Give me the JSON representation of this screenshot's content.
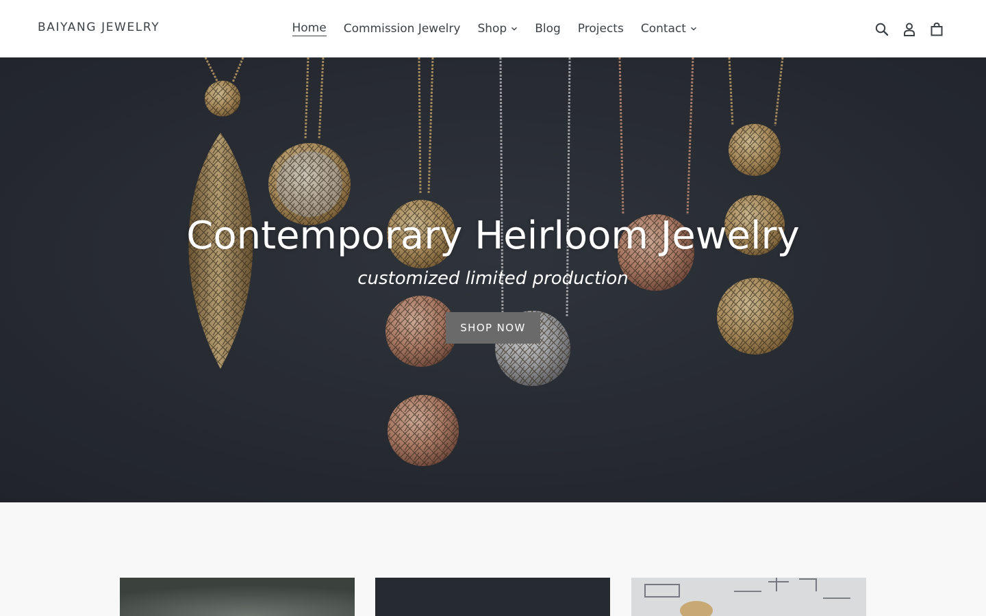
{
  "header": {
    "logo": "BAIYANG JEWELRY",
    "nav": [
      {
        "label": "Home",
        "active": true,
        "dropdown": false
      },
      {
        "label": "Commission Jewelry",
        "active": false,
        "dropdown": false
      },
      {
        "label": "Shop",
        "active": false,
        "dropdown": true
      },
      {
        "label": "Blog",
        "active": false,
        "dropdown": false
      },
      {
        "label": "Projects",
        "active": false,
        "dropdown": false
      },
      {
        "label": "Contact",
        "active": false,
        "dropdown": true
      }
    ],
    "icons": [
      "search-icon",
      "account-icon",
      "cart-icon"
    ]
  },
  "hero": {
    "title": "Contemporary Heirloom Jewelry",
    "subtitle": "customized limited production",
    "button_label": "SHOP NOW"
  },
  "colors": {
    "text": "#3d4246",
    "hero_bg": "#2c3036",
    "button_bg": "#6a6a6a",
    "page_bg": "#f8f8f8"
  }
}
